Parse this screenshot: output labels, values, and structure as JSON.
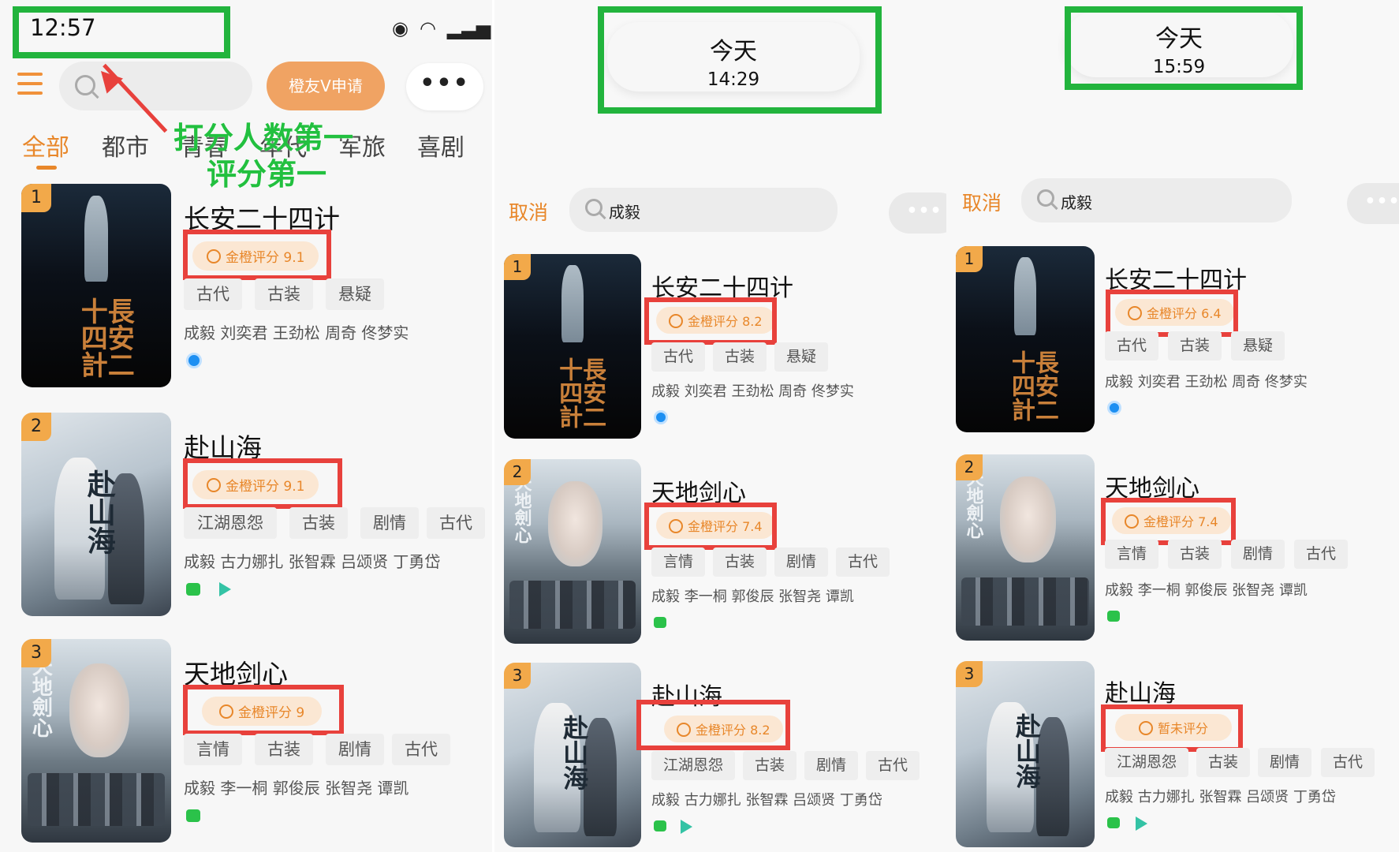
{
  "colors": {
    "accent": "#e8872a",
    "annotation_green": "#22b43d",
    "annotation_red": "#e8413c",
    "rank_badge": "#f2a94a"
  },
  "panel1": {
    "status_time": "12:57",
    "status_icons": [
      "eye-icon",
      "wifi-icon",
      "signal-icon"
    ],
    "vip_button_label": "橙友V申请",
    "more_label": "•••",
    "tabs": [
      "全部",
      "都市",
      "青春",
      "年代",
      "军旅",
      "喜剧"
    ],
    "annotation_line1": "打分人数第一",
    "annotation_line2": "评分第一",
    "items": [
      {
        "rank": "1",
        "title": "长安二十四计",
        "rating": "金橙评分 9.1",
        "tags": [
          "古代",
          "古装",
          "悬疑"
        ],
        "cast": "成毅 刘奕君 王劲松 周奇 佟梦实",
        "platforms": [
          "tencent-video-icon"
        ]
      },
      {
        "rank": "2",
        "title": "赴山海",
        "rating": "金橙评分 9.1",
        "tags": [
          "江湖恩怨",
          "古装",
          "剧情",
          "古代"
        ],
        "cast": "成毅 古力娜扎 张智霖 吕颂贤 丁勇岱",
        "platforms": [
          "iqiyi-icon",
          "youku-icon"
        ]
      },
      {
        "rank": "3",
        "title": "天地剑心",
        "rating": "金橙评分 9",
        "tags": [
          "言情",
          "古装",
          "剧情",
          "古代"
        ],
        "cast": "成毅 李一桐 郭俊辰 张智尧 谭凯",
        "platforms": [
          "iqiyi-icon"
        ]
      }
    ]
  },
  "panel2": {
    "header_day": "今天",
    "header_time": "14:29",
    "cancel_label": "取消",
    "search_query": "成毅",
    "more_label": "•••",
    "items": [
      {
        "rank": "1",
        "title": "长安二十四计",
        "rating": "金橙评分 8.2",
        "tags": [
          "古代",
          "古装",
          "悬疑"
        ],
        "cast": "成毅 刘奕君 王劲松 周奇 佟梦实",
        "platforms": [
          "tencent-video-icon"
        ]
      },
      {
        "rank": "2",
        "title": "天地剑心",
        "rating": "金橙评分 7.4",
        "tags": [
          "言情",
          "古装",
          "剧情",
          "古代"
        ],
        "cast": "成毅 李一桐 郭俊辰 张智尧 谭凯",
        "platforms": [
          "iqiyi-icon"
        ]
      },
      {
        "rank": "3",
        "title": "赴山海",
        "rating": "金橙评分 8.2",
        "tags": [
          "江湖恩怨",
          "古装",
          "剧情",
          "古代"
        ],
        "cast": "成毅 古力娜扎 张智霖 吕颂贤 丁勇岱",
        "platforms": [
          "iqiyi-icon",
          "youku-icon"
        ]
      }
    ]
  },
  "panel3": {
    "header_day": "今天",
    "header_time": "15:59",
    "cancel_label": "取消",
    "search_query": "成毅",
    "more_label": "•••",
    "items": [
      {
        "rank": "1",
        "title": "长安二十四计",
        "rating": "金橙评分 6.4",
        "tags": [
          "古代",
          "古装",
          "悬疑"
        ],
        "cast": "成毅 刘奕君 王劲松 周奇 佟梦实",
        "platforms": [
          "tencent-video-icon"
        ]
      },
      {
        "rank": "2",
        "title": "天地剑心",
        "rating": "金橙评分 7.4",
        "tags": [
          "言情",
          "古装",
          "剧情",
          "古代"
        ],
        "cast": "成毅 李一桐 郭俊辰 张智尧 谭凯",
        "platforms": [
          "iqiyi-icon"
        ]
      },
      {
        "rank": "3",
        "title": "赴山海",
        "rating": "暂未评分",
        "tags": [
          "江湖恩怨",
          "古装",
          "剧情",
          "古代"
        ],
        "cast": "成毅 古力娜扎 张智霖 吕颂贤 丁勇岱",
        "platforms": [
          "iqiyi-icon",
          "youku-icon"
        ]
      }
    ]
  },
  "poster_text": {
    "changan": "長安二十四計",
    "fushanhai": "赴山海",
    "tiandi": "天地劍心"
  }
}
